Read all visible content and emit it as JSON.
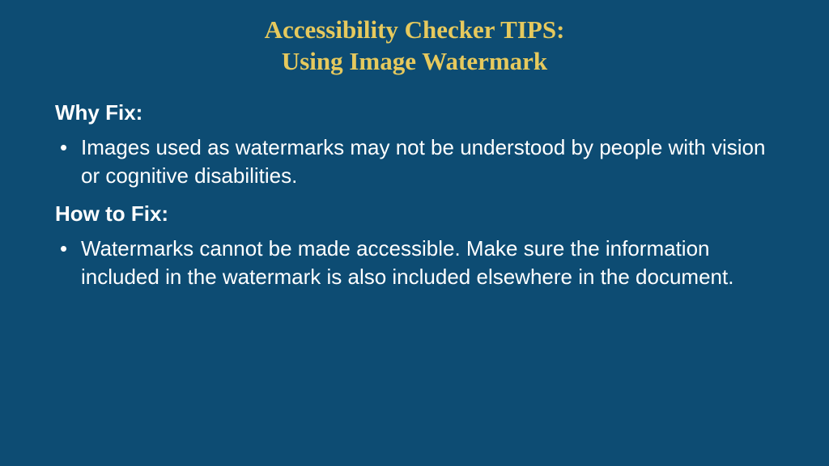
{
  "title": {
    "line1": "Accessibility Checker TIPS:",
    "line2": "Using Image Watermark"
  },
  "sections": [
    {
      "heading": "Why Fix:",
      "bullets": [
        "Images  used as watermarks may not be understood by people with vision or cognitive disabilities."
      ]
    },
    {
      "heading": "How to Fix:",
      "bullets": [
        "Watermarks cannot be made accessible. Make sure the information included in the watermark is also included elsewhere in the document."
      ]
    }
  ]
}
